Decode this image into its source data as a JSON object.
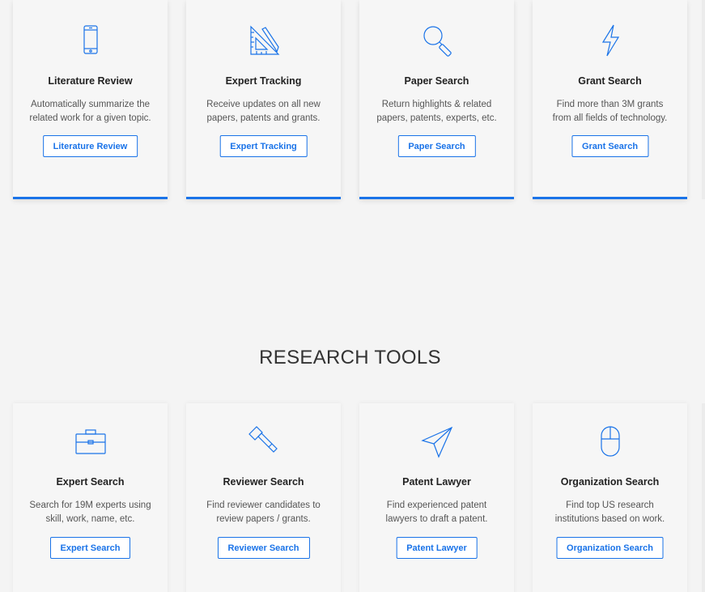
{
  "top_cards": [
    {
      "icon": "smartphone-icon",
      "title": "Literature Review",
      "desc_line1": "Automatically summarize the",
      "desc_line2": "related work for a given topic.",
      "button": "Literature Review"
    },
    {
      "icon": "ruler-pencil-icon",
      "title": "Expert Tracking",
      "desc_line1": "Receive updates on all new",
      "desc_line2": "papers, patents and grants.",
      "button": "Expert Tracking"
    },
    {
      "icon": "magnifier-icon",
      "title": "Paper Search",
      "desc_line1": "Return highlights & related",
      "desc_line2": "papers, patents, experts, etc.",
      "button": "Paper Search"
    },
    {
      "icon": "lightning-icon",
      "title": "Grant Search",
      "desc_line1": "Find more than 3M grants",
      "desc_line2": "from all fields of technology.",
      "button": "Grant Search"
    }
  ],
  "section": {
    "title": "RESEARCH TOOLS"
  },
  "bottom_cards": [
    {
      "icon": "briefcase-icon",
      "title": "Expert Search",
      "desc_line1": "Search for 19M experts using",
      "desc_line2": "skill, work, name, etc.",
      "button": "Expert Search"
    },
    {
      "icon": "hammer-icon",
      "title": "Reviewer Search",
      "desc_line1": "Find reviewer candidates to",
      "desc_line2": "review papers / grants.",
      "button": "Reviewer Search"
    },
    {
      "icon": "paper-plane-icon",
      "title": "Patent Lawyer",
      "desc_line1": "Find experienced patent",
      "desc_line2": "lawyers to draft a patent.",
      "button": "Patent Lawyer"
    },
    {
      "icon": "mouse-icon",
      "title": "Organization Search",
      "desc_line1": "Find top US research",
      "desc_line2": "institutions based on work.",
      "button": "Organization Search"
    }
  ],
  "colors": {
    "accent": "#1a73e8",
    "background": "#f4f4f4",
    "card": "#f6f6f6"
  }
}
